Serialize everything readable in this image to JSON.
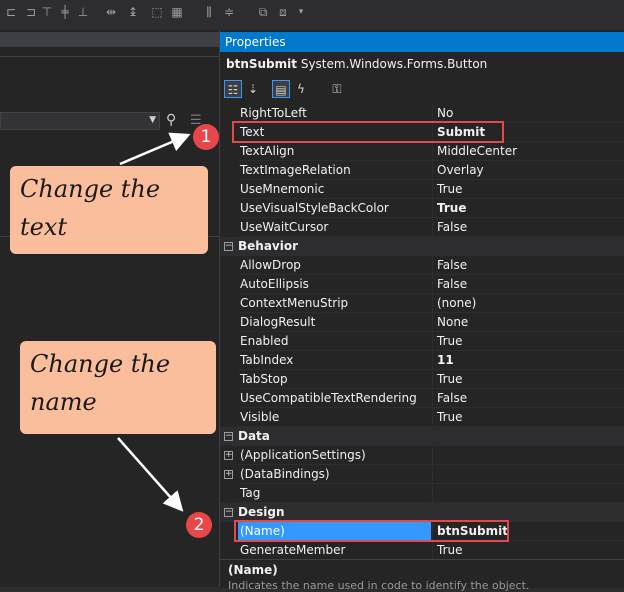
{
  "properties_panel": {
    "title": "Properties",
    "object_name": "btnSubmit",
    "object_type": "System.Windows.Forms.Button",
    "rows": [
      {
        "kind": "prop",
        "name": "RightToLeft",
        "value": "No"
      },
      {
        "kind": "prop",
        "name": "Text",
        "value": "Submit",
        "bold": true
      },
      {
        "kind": "prop",
        "name": "TextAlign",
        "value": "MiddleCenter"
      },
      {
        "kind": "prop",
        "name": "TextImageRelation",
        "value": "Overlay"
      },
      {
        "kind": "prop",
        "name": "UseMnemonic",
        "value": "True"
      },
      {
        "kind": "prop",
        "name": "UseVisualStyleBackColor",
        "value": "True",
        "bold": true
      },
      {
        "kind": "prop",
        "name": "UseWaitCursor",
        "value": "False"
      },
      {
        "kind": "category",
        "name": "Behavior",
        "expanded": true
      },
      {
        "kind": "prop",
        "name": "AllowDrop",
        "value": "False"
      },
      {
        "kind": "prop",
        "name": "AutoEllipsis",
        "value": "False"
      },
      {
        "kind": "prop",
        "name": "ContextMenuStrip",
        "value": "(none)"
      },
      {
        "kind": "prop",
        "name": "DialogResult",
        "value": "None"
      },
      {
        "kind": "prop",
        "name": "Enabled",
        "value": "True"
      },
      {
        "kind": "prop",
        "name": "TabIndex",
        "value": "11",
        "bold": true
      },
      {
        "kind": "prop",
        "name": "TabStop",
        "value": "True"
      },
      {
        "kind": "prop",
        "name": "UseCompatibleTextRendering",
        "value": "False"
      },
      {
        "kind": "prop",
        "name": "Visible",
        "value": "True"
      },
      {
        "kind": "category",
        "name": "Data",
        "expanded": true
      },
      {
        "kind": "prop",
        "name": "(ApplicationSettings)",
        "value": "",
        "expandable": true
      },
      {
        "kind": "prop",
        "name": "(DataBindings)",
        "value": "",
        "expandable": true
      },
      {
        "kind": "prop",
        "name": "Tag",
        "value": ""
      },
      {
        "kind": "category",
        "name": "Design",
        "expanded": true
      },
      {
        "kind": "prop",
        "name": "(Name)",
        "value": "btnSubmit",
        "bold": true,
        "selected": true
      },
      {
        "kind": "prop",
        "name": "GenerateMember",
        "value": "True"
      }
    ],
    "description_title": "(Name)",
    "description_text": "Indicates the name used in code to identify the object."
  },
  "annotations": {
    "callout1": "Change the text",
    "callout2": "Change the name",
    "marker1": "1",
    "marker2": "2"
  },
  "colors": {
    "title_bar": "#007acc",
    "highlight": "#e04a4a",
    "callout_bg": "#fbbe9c",
    "selection": "#3399ff"
  },
  "icons": {
    "properties_toolbar": [
      "categorized-icon",
      "alphabetical-icon",
      "properties-icon",
      "events-icon",
      "property-pages-icon"
    ],
    "left_panel": [
      "dropdown-arrow-icon",
      "search-icon",
      "menu-icon"
    ]
  }
}
